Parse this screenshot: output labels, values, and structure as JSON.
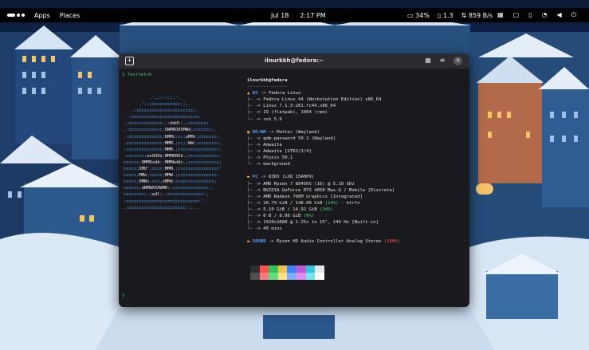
{
  "topbar": {
    "apps_label": "Apps",
    "places_label": "Places",
    "date": "Jul 18",
    "time": "2:17 PM",
    "cpu": "34%",
    "mem": "1.3",
    "net": "859 B/s"
  },
  "terminal": {
    "title": "ilnurkkh@fedora:~",
    "command": "fastfetch",
    "info": {
      "user_host": "ilnurkkh@fedora",
      "separator": "---------------",
      "os_label": "OS",
      "os_value": "-> Fedora Linux",
      "os_lines": [
        "-> Fedora Linux 44 (Workstation Edition) x86_64",
        "-> Linux 7.1.3-201.fc44.x86_64",
        "-> 19 (flatpak), 1964 (rpm)",
        "-> zsh 5.9"
      ],
      "de_label": "DE/WM",
      "de_value": "-> Mutter (Wayland)",
      "de_lines": [
        "-> gdm-password 50.1 (Wayland)",
        "-> Adwaita",
        "-> Adwaita [GTK2/3/4]",
        "-> Ptyxis 50.1",
        "-> background"
      ],
      "pc_label": "PC",
      "pc_value": "-> 83DX (LOQ 15AHP9)",
      "pc_lines": [
        "-> AMD Ryzen 7 8845HS (16) @ 5.10 GHz",
        "-> NVIDIA GeForce RTX 4050 Max-Q / Mobile [Discrete]",
        "-> AMD Radeon 780M Graphics [Integrated]",
        "-> 20.79 GiB / 148.00 GiB",
        "-> 5.10 GiB / 14.92 GiB",
        "-> 0 B / 8.00 GiB",
        "-> 1920x1080 @ 1.25x in 15\", 144 Hz [Built-in]",
        "-> 40 mins"
      ],
      "disk_pct": "(14%)",
      "disk_fs": "- btrfs",
      "mem_pct": "(34%)",
      "swap_pct": "(0%)",
      "sound_label": "SOUND",
      "sound_value": "-> Ryzen HD Audio Controller Analog Stereo",
      "sound_pct": "(100%)"
    },
    "palette": [
      "#2e2e2e",
      "#ff4f4f",
      "#33c45a",
      "#f0c24d",
      "#3b82ff",
      "#c25ad6",
      "#2ec8d8",
      "#e6e6e6"
    ],
    "palette_bright": [
      "#505050",
      "#ff7a7a",
      "#5fe07f",
      "#ffe07a",
      "#7ab0ff",
      "#e28af0",
      "#6ee8f2",
      "#ffffff"
    ]
  }
}
